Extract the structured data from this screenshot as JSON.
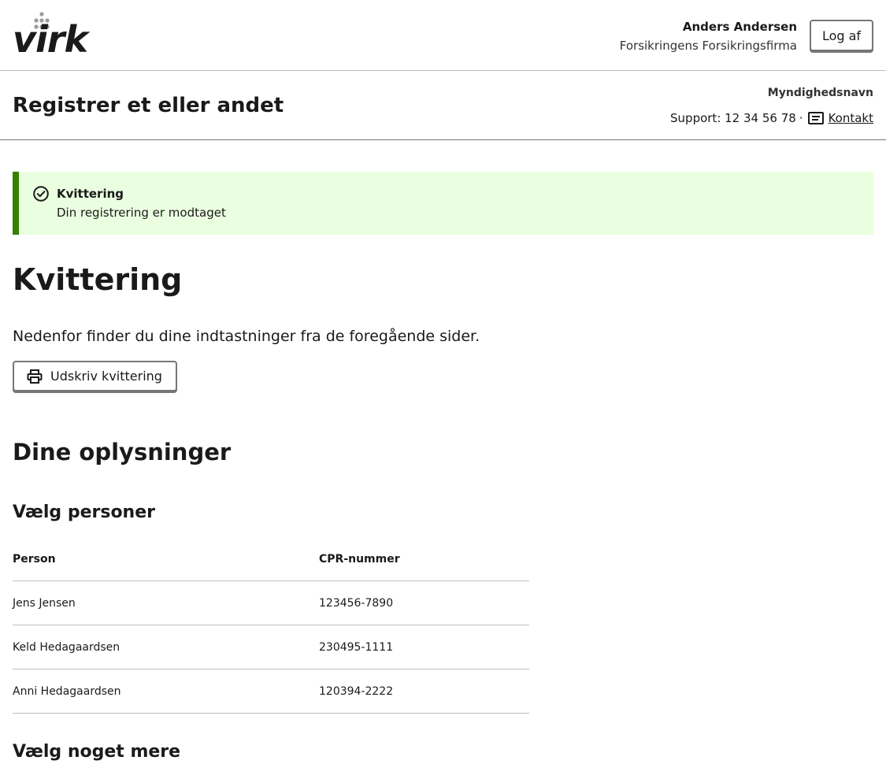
{
  "header": {
    "logo_text": "virk",
    "user_name": "Anders Andersen",
    "company": "Forsikringens Forsikringsfirma",
    "logout_label": "Log af"
  },
  "subheader": {
    "site_title": "Registrer et eller andet",
    "authority": "Myndighedsnavn",
    "support_label": "Support: 12 34 56 78",
    "separator": "·",
    "contact_label": "Kontakt"
  },
  "alert": {
    "heading": "Kvittering",
    "text": "Din registrering er modtaget",
    "color": "#358000"
  },
  "main": {
    "heading": "Kvittering",
    "intro": "Nedenfor finder du dine indtastninger fra de foregående sider.",
    "print_label": "Udskriv kvittering",
    "section_heading": "Dine oplysninger",
    "persons_heading": "Vælg personer",
    "next_heading": "Vælg noget mere"
  },
  "persons_table": {
    "columns": [
      "Person",
      "CPR-nummer"
    ],
    "rows": [
      [
        "Jens Jensen",
        "123456-7890"
      ],
      [
        "Keld Hedagaardsen",
        "230495-1111"
      ],
      [
        "Anni Hedagaardsen",
        "120394-2222"
      ]
    ]
  }
}
